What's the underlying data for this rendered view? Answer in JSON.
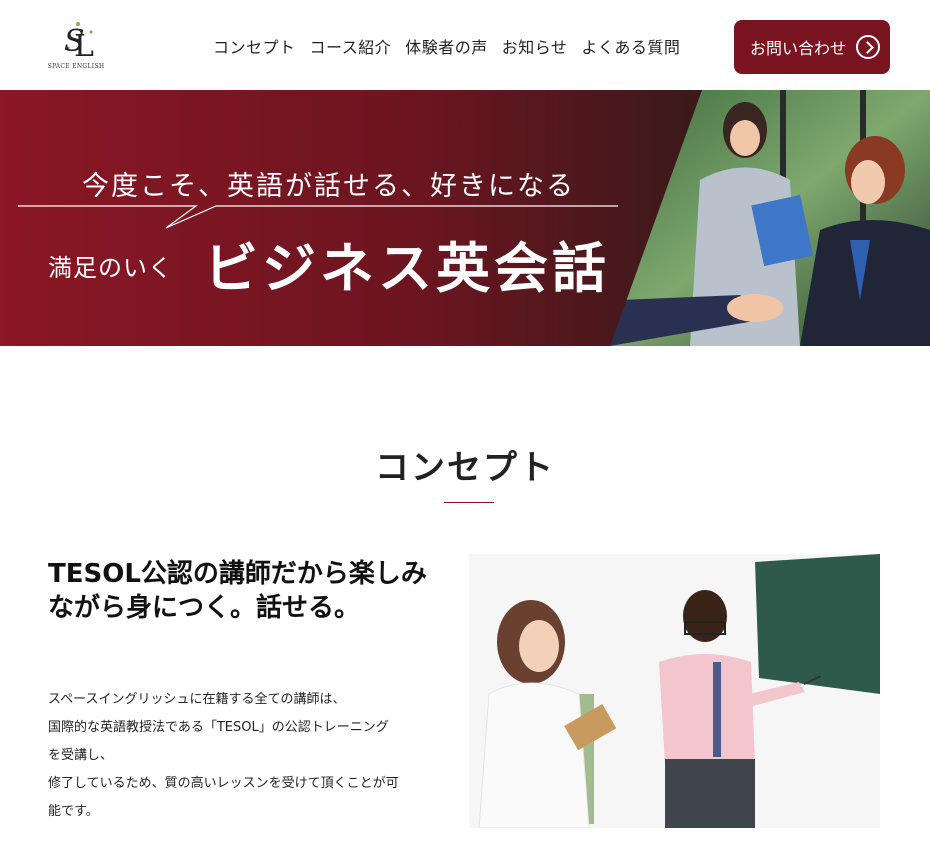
{
  "header": {
    "logo_text": "SPACE ENGLISH",
    "nav": [
      "コンセプト",
      "コース紹介",
      "体験者の声",
      "お知らせ",
      "よくある質問"
    ],
    "contact_label": "お問い合わせ"
  },
  "hero": {
    "subtitle": "今度こそ、英語が話せる、好きになる",
    "lead": "満足のいく",
    "title": "ビジネス英会話"
  },
  "concept": {
    "title": "コンセプト",
    "headline": "TESOL公認の講師だから楽しみながら身につく。話せる。",
    "body": [
      "スペースイングリッシュに在籍する全ての講師は、",
      "国際的な英語教授法である「TESOL」の公認トレーニング",
      "を受講し、",
      "修了しているため、質の高いレッスンを受けて頂くことが可",
      "能です。"
    ]
  },
  "colors": {
    "brand": "#7a1420",
    "gold": "#b8955a"
  }
}
